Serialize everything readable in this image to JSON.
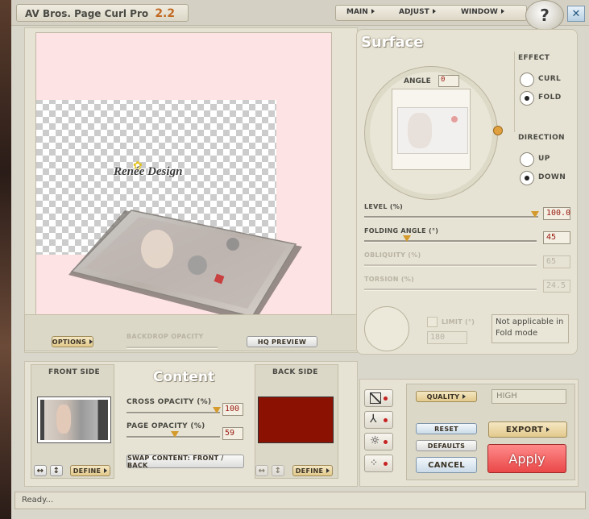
{
  "title": {
    "name": "AV Bros. Page Curl Pro",
    "version": "2.2"
  },
  "menu": [
    "MAIN",
    "ADJUST",
    "WINDOW"
  ],
  "help_label": "?",
  "close_label": "✕",
  "preview": {
    "watermark": "Renée Design"
  },
  "below_preview": {
    "options_label": "OPTIONS",
    "backdrop_label": "BACKDROP OPACITY",
    "hq_label": "HQ PREVIEW"
  },
  "surface": {
    "title": "Surface",
    "angle_label": "ANGLE",
    "angle_value": "0",
    "effect_label": "EFFECT",
    "effect_options": [
      "CURL",
      "FOLD"
    ],
    "effect_selected": "FOLD",
    "direction_label": "DIRECTION",
    "direction_options": [
      "UP",
      "DOWN"
    ],
    "direction_selected": "DOWN",
    "sliders": [
      {
        "label": "LEVEL (%)",
        "value": "100.0",
        "fraction": 1.0,
        "enabled": true
      },
      {
        "label": "FOLDING ANGLE (°)",
        "value": "45",
        "fraction": 0.25,
        "enabled": true
      },
      {
        "label": "OBLIQUITY (%)",
        "value": "65",
        "fraction": 0.0,
        "enabled": false
      },
      {
        "label": "TORSION (%)",
        "value": "24.5",
        "fraction": 0.0,
        "enabled": false
      }
    ],
    "limit_label": "LIMIT (°)",
    "limit_value": "180",
    "note": "Not applicable in Fold mode"
  },
  "content": {
    "title": "Content",
    "front_label": "FRONT SIDE",
    "back_label": "BACK SIDE",
    "cross_label": "CROSS OPACITY (%)",
    "cross_value": "100",
    "cross_fraction": 1.0,
    "page_label": "PAGE OPACITY (%)",
    "page_value": "59",
    "page_fraction": 0.5,
    "swap_label": "SWAP CONTENT: FRONT / BACK",
    "define_label": "DEFINE",
    "flip_h": "↔",
    "flip_v": "↕",
    "back_color": "#8b1203"
  },
  "actions": {
    "quality_label": "QUALITY",
    "quality_value": "HIGH",
    "reset_label": "RESET",
    "defaults_label": "DEFAULTS",
    "cancel_label": "CANCEL",
    "export_label": "EXPORT",
    "apply_label": "Apply"
  },
  "status": "Ready..."
}
